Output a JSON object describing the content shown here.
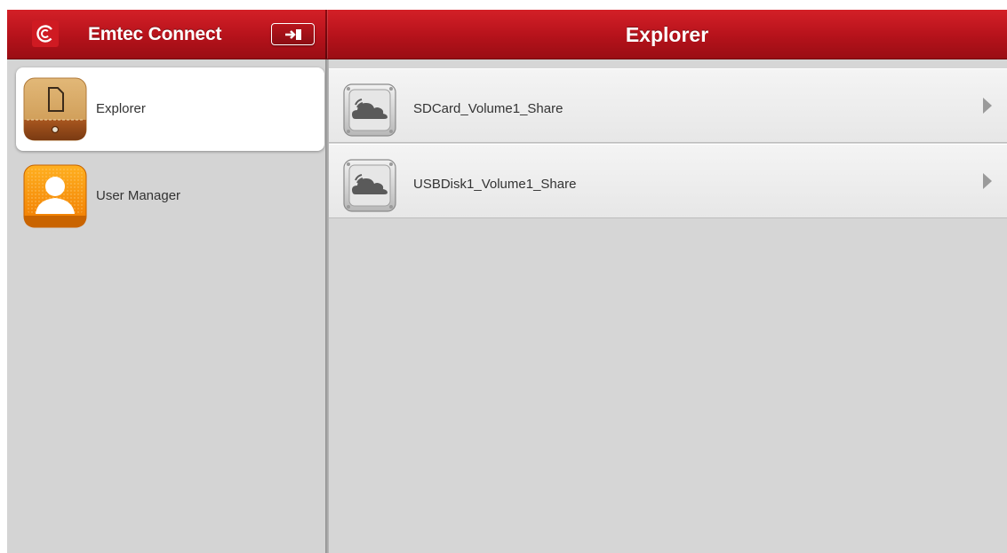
{
  "header": {
    "app_title": "Emtec Connect",
    "page_title": "Explorer",
    "logo_icon": "emtec-logo-icon",
    "logout_icon": "logout-icon"
  },
  "sidebar": {
    "items": [
      {
        "label": "Explorer",
        "icon": "folder-icon",
        "active": true
      },
      {
        "label": "User Manager",
        "icon": "user-icon",
        "active": false
      }
    ]
  },
  "main": {
    "shares": [
      {
        "label": "SDCard_Volume1_Share",
        "icon": "cloud-drive-icon"
      },
      {
        "label": "USBDisk1_Volume1_Share",
        "icon": "cloud-drive-icon"
      }
    ]
  },
  "colors": {
    "header_red": "#b5121b",
    "sidebar_bg": "#d4d4d4",
    "row_bg": "#efefef"
  }
}
